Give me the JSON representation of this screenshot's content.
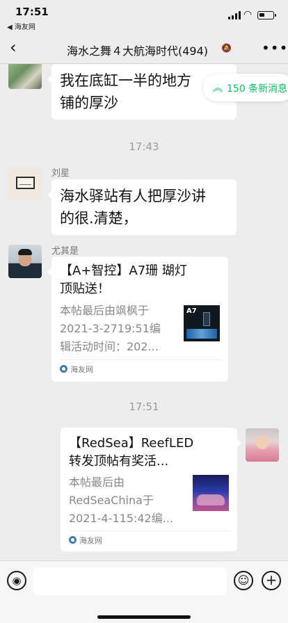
{
  "status_bar": {
    "time": "17:51",
    "back_app": "◀ 海友网"
  },
  "nav": {
    "back_icon": "chevron-left-icon",
    "title": "海水之舞４大航海时代(494)",
    "more_icon": "more-icon"
  },
  "new_messages": {
    "label": "150 条新消息",
    "color": "#07c160"
  },
  "messages": [
    {
      "type": "text",
      "sender": "",
      "text_lines": [
        "我在底缸一半的地方",
        "铺的厚沙"
      ]
    },
    {
      "type": "timestamp",
      "text": "17:43"
    },
    {
      "type": "text",
      "sender": "刘星",
      "text_lines": [
        "海水驿站有人把厚沙讲",
        "的很.清楚，"
      ]
    },
    {
      "type": "card",
      "sender": "尤其是",
      "title_lines": [
        "【A+智控】A7珊 瑚灯",
        "顶贴送！"
      ],
      "desc_lines": [
        "本帖最后由飒枫于",
        "2021-3-2719:51编",
        "辑活动时间：202..."
      ],
      "thumb_label": "A7",
      "source": "海友网"
    },
    {
      "type": "timestamp",
      "text": "17:51"
    },
    {
      "type": "card",
      "sender": "",
      "title_lines": [
        "【RedSea】ReefLED",
        "转发顶帖有奖活..."
      ],
      "desc_lines": [
        "本帖最后由",
        "RedSeaChina于",
        "2021-4-115:42编..."
      ],
      "source": "海友网"
    }
  ],
  "input_bar": {
    "voice_icon": "voice-icon",
    "emoji_icon": "emoji-icon",
    "plus_icon": "plus-icon"
  }
}
